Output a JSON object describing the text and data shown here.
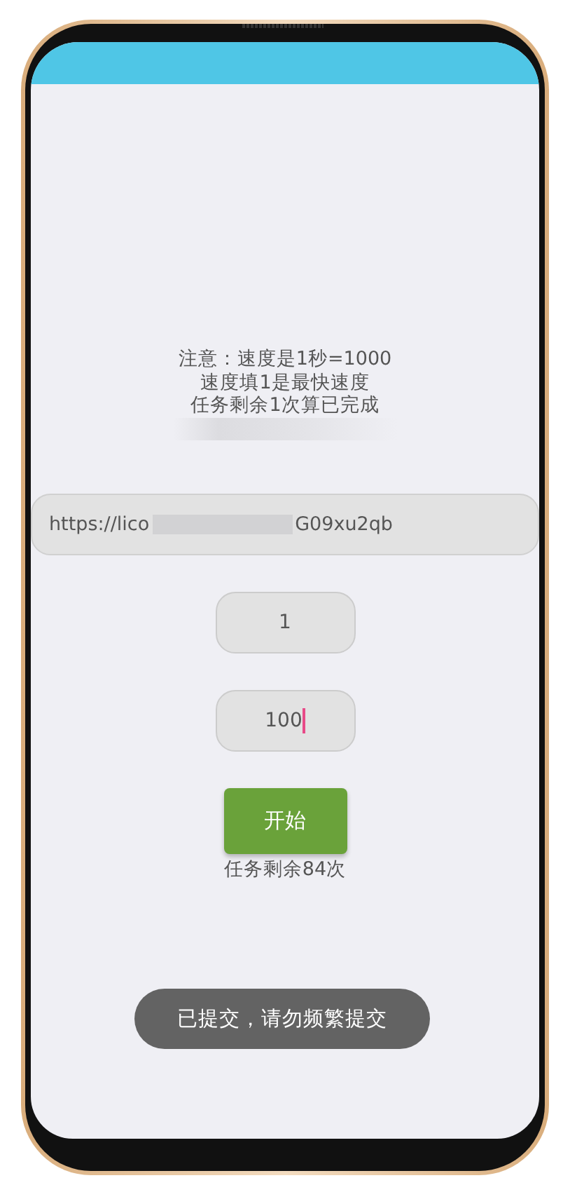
{
  "notice": {
    "lines": [
      "注意：速度是1秒=1000",
      "速度填1是最快速度",
      "任务剩余1次算已完成"
    ]
  },
  "url_field": {
    "value_start": "https://lico",
    "value_end": "G09xu2qb"
  },
  "fields": [
    {
      "value": "1",
      "focused": false
    },
    {
      "value": "100",
      "focused": true
    }
  ],
  "start_button": {
    "label": "开始"
  },
  "remaining": "任务剩余84次",
  "toast": "已提交，请勿频繁提交"
}
